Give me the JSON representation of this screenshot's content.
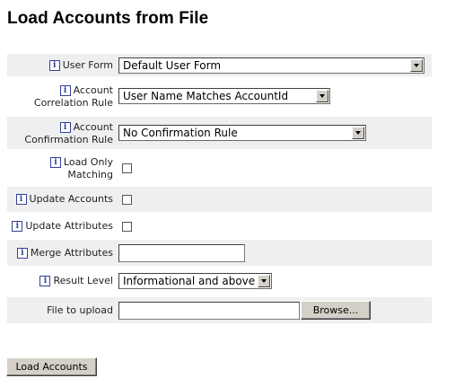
{
  "page": {
    "title": "Load Accounts from File"
  },
  "form": {
    "user_form": {
      "label": "User Form",
      "value": "Default User Form"
    },
    "correlation_rule": {
      "label_line1": "Account",
      "label_line2": "Correlation Rule",
      "value": "User Name Matches AccountId"
    },
    "confirmation_rule": {
      "label_line1": "Account",
      "label_line2": "Confirmation Rule",
      "value": "No Confirmation Rule"
    },
    "load_only_matching": {
      "label_line1": "Load Only",
      "label_line2": "Matching",
      "checked": false
    },
    "update_accounts": {
      "label": "Update Accounts",
      "checked": false
    },
    "update_attributes": {
      "label": "Update Attributes",
      "checked": false
    },
    "merge_attributes": {
      "label": "Merge Attributes",
      "value": ""
    },
    "result_level": {
      "label": "Result Level",
      "value": "Informational and above"
    },
    "file_upload": {
      "label": "File to upload",
      "value": "",
      "browse_label": "Browse..."
    }
  },
  "actions": {
    "load_accounts_label": "Load Accounts"
  },
  "icons": {
    "info_glyph": "i"
  }
}
